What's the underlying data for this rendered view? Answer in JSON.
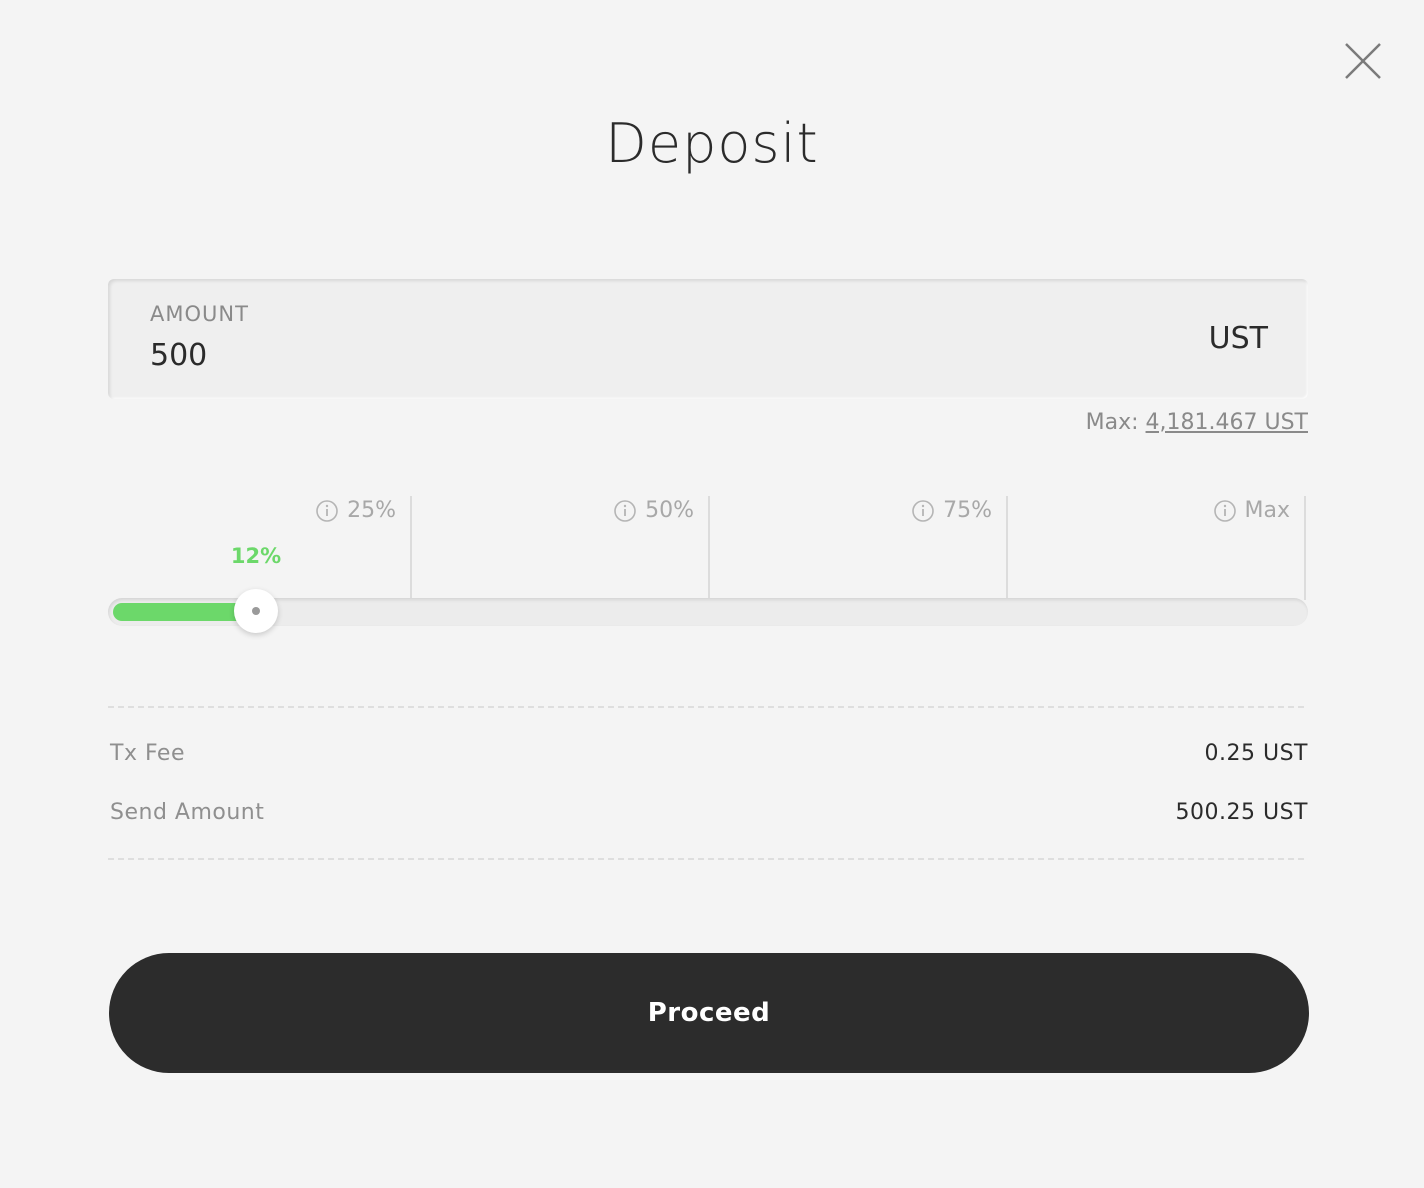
{
  "modal": {
    "title": "Deposit",
    "close_icon": "close-icon"
  },
  "amount": {
    "label": "AMOUNT",
    "value": "500",
    "unit": "UST"
  },
  "max": {
    "prefix": "Max:",
    "value": "4,181.467 UST"
  },
  "slider": {
    "percent_label": "12%",
    "value_fraction": 0.12,
    "fill_color": "#6cd86a",
    "ticks": [
      {
        "label": "25%",
        "icon": "info-icon"
      },
      {
        "label": "50%",
        "icon": "info-icon"
      },
      {
        "label": "75%",
        "icon": "info-icon"
      },
      {
        "label": "Max",
        "icon": "info-icon"
      }
    ]
  },
  "summary": {
    "tx_fee_label": "Tx Fee",
    "tx_fee_value": "0.25 UST",
    "send_amount_label": "Send Amount",
    "send_amount_value": "500.25 UST"
  },
  "actions": {
    "proceed_label": "Proceed",
    "proceed_bg": "#2c2c2c"
  }
}
